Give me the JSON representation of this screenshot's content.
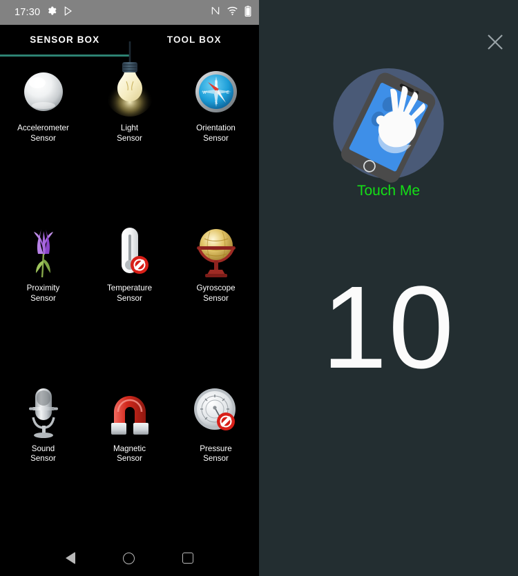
{
  "status_bar": {
    "clock": "17:30",
    "left_icons": [
      "gear-icon",
      "play-store-icon"
    ],
    "right_icons": [
      "nfc-icon",
      "wifi-icon",
      "battery-icon"
    ],
    "background": "#828282"
  },
  "tabs": {
    "items": [
      {
        "label": "SENSOR BOX",
        "active": true
      },
      {
        "label": "TOOL BOX",
        "active": false
      }
    ],
    "indicator_color": "#2d8273"
  },
  "sensors": [
    {
      "label": "Accelerometer\nSensor",
      "icon": "silver-ball-icon",
      "available": true
    },
    {
      "label": "Light\nSensor",
      "icon": "light-bulb-icon",
      "available": true
    },
    {
      "label": "Orientation\nSensor",
      "icon": "compass-icon",
      "available": true
    },
    {
      "label": "Proximity\nSensor",
      "icon": "flower-icon",
      "available": true
    },
    {
      "label": "Temperature\nSensor",
      "icon": "thermometer-icon",
      "available": false
    },
    {
      "label": "Gyroscope\nSensor",
      "icon": "globe-icon",
      "available": true
    },
    {
      "label": "Sound\nSensor",
      "icon": "microphone-icon",
      "available": true
    },
    {
      "label": "Magnetic\nSensor",
      "icon": "magnet-icon",
      "available": true
    },
    {
      "label": "Pressure\nSensor",
      "icon": "barometer-icon",
      "available": false
    }
  ],
  "nav_bar": {
    "back": "back-triangle-icon",
    "home": "home-circle-icon",
    "recents": "recents-square-icon"
  },
  "right_panel": {
    "background": "#232e31",
    "close_icon": "close-icon",
    "illustration": "hand-on-phone-icon",
    "label": "Touch Me",
    "label_color": "#14e016",
    "count": "10",
    "count_color": "#fbfbfb"
  }
}
